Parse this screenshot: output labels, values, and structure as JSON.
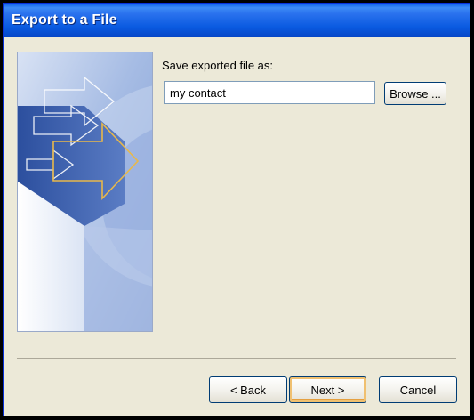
{
  "window": {
    "title": "Export to a File"
  },
  "form": {
    "save_label": "Save exported file as:",
    "filename_value": "my contact",
    "browse_label": "Browse ..."
  },
  "buttons": {
    "back_label": "< Back",
    "next_label": "Next >",
    "cancel_label": "Cancel"
  },
  "colors": {
    "titlebar": "#0a5ae0",
    "dialog_bg": "#ece9d8",
    "arrow_accent": "#e8b84a"
  },
  "icons": {
    "wizard_graphic": "export-arrows-icon"
  }
}
